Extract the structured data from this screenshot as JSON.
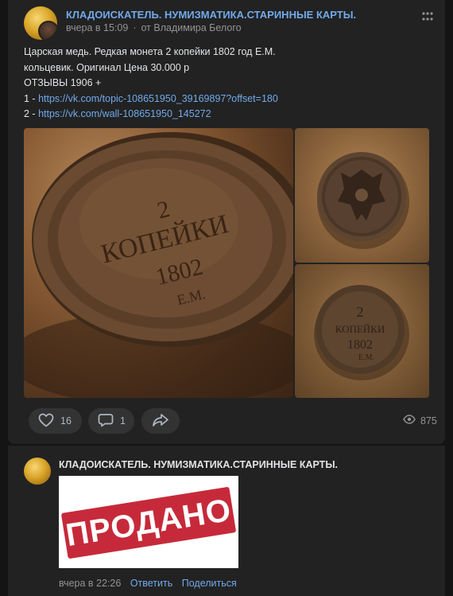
{
  "post": {
    "author": "КЛАДОИСКАТЕЛЬ. НУМИЗМАТИКА.СТАРИННЫЕ КАРТЫ.",
    "time": "вчера в 15:09",
    "dot": "·",
    "from": "от Владимира Белого",
    "text_line1": "Царская медь. Редкая монета 2 копейки 1802 год Е.М.",
    "text_line2": "кольцевик. Оригинал Цена 30.000 р",
    "text_line3": "ОТЗЫВЫ 1906 +",
    "link1_prefix": "1 - ",
    "link1": "https://vk.com/topic-108651950_39169897?offset=180",
    "link2_prefix": "2 - ",
    "link2": "https://vk.com/wall-108651950_145272",
    "likes": "16",
    "comments": "1",
    "views": "875"
  },
  "comment": {
    "author": "КЛАДОИСКАТЕЛЬ. НУМИЗМАТИКА.СТАРИННЫЕ КАРТЫ.",
    "image_text": "ПРОДАНО",
    "time": "вчера в 22:26",
    "reply": "Ответить",
    "share": "Поделиться"
  },
  "coin": {
    "denomination_num": "2",
    "denomination_word": "КОПЕЙКИ",
    "year": "1802",
    "mint": "Е.М."
  },
  "colors": {
    "link": "#71aaeb",
    "card_bg": "#222222",
    "page_bg": "#141414",
    "sold_red": "#c62a3a"
  },
  "icons": [
    "more-icon",
    "heart-icon",
    "comment-icon",
    "share-icon",
    "eye-icon"
  ]
}
